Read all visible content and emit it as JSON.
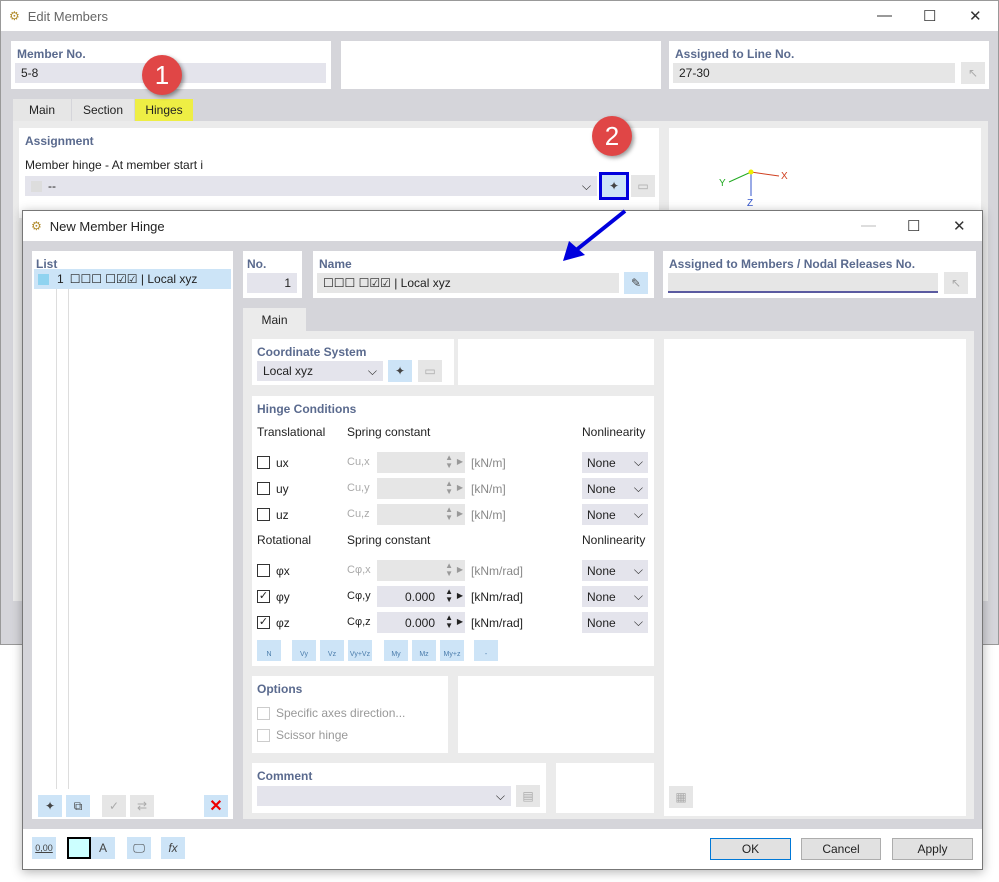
{
  "back": {
    "title": "Edit Members",
    "member_no_label": "Member No.",
    "member_no": "5-8",
    "assigned_line_label": "Assigned to Line No.",
    "assigned_line": "27-30",
    "tabs": [
      "Main",
      "Section",
      "Hinges"
    ],
    "assignment_label": "Assignment",
    "hinge_start_label": "Member hinge - At member start i",
    "hinge_start_value": "--",
    "axes": {
      "x": "X",
      "y": "Y",
      "z": "Z"
    },
    "badge1": "1",
    "badge2": "2",
    "tab_highlight": "#eeee44",
    "callout_color": "#0000dd"
  },
  "dialog": {
    "title": "New Member Hinge",
    "list_label": "List",
    "list_items": [
      {
        "no": "1",
        "name": "☐☐☐ ☐☑☑ | Local xyz"
      }
    ],
    "no_label": "No.",
    "no_value": "1",
    "name_label": "Name",
    "name_value": "☐☐☐ ☐☑☑ | Local xyz",
    "assigned_label": "Assigned to Members / Nodal Releases No.",
    "assigned_value": "",
    "tab": "Main",
    "coord_label": "Coordinate System",
    "coord_value": "Local xyz",
    "hinge_label": "Hinge Conditions",
    "translational": "Translational",
    "rotational": "Rotational",
    "spring_constant": "Spring constant",
    "nonlinearity": "Nonlinearity",
    "trans_rows": [
      {
        "label": "ux",
        "c": "Cu,x",
        "value": "",
        "unit": "[kN/m]",
        "checked": false,
        "nl": "None"
      },
      {
        "label": "uy",
        "c": "Cu,y",
        "value": "",
        "unit": "[kN/m]",
        "checked": false,
        "nl": "None"
      },
      {
        "label": "uz",
        "c": "Cu,z",
        "value": "",
        "unit": "[kN/m]",
        "checked": false,
        "nl": "None"
      }
    ],
    "rot_rows": [
      {
        "label": "φx",
        "c": "Cφ,x",
        "value": "",
        "unit": "[kNm/rad]",
        "checked": false,
        "nl": "None"
      },
      {
        "label": "φy",
        "c": "Cφ,y",
        "value": "0.000",
        "unit": "[kNm/rad]",
        "checked": true,
        "nl": "None"
      },
      {
        "label": "φz",
        "c": "Cφ,z",
        "value": "0.000",
        "unit": "[kNm/rad]",
        "checked": true,
        "nl": "None"
      }
    ],
    "preset_buttons": [
      "N",
      "Vy",
      "Vz",
      "Vy+Vz",
      "My",
      "Mz",
      "My+z",
      "-"
    ],
    "options_label": "Options",
    "opt_specific": "Specific axes direction...",
    "opt_scissor": "Scissor hinge",
    "comment_label": "Comment",
    "comment_value": "",
    "ok": "OK",
    "cancel": "Cancel",
    "apply": "Apply",
    "units_btn": "0,00"
  }
}
